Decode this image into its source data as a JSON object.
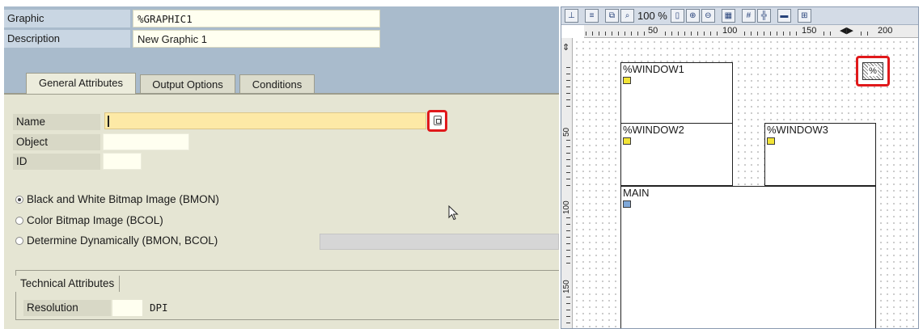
{
  "header": {
    "graphic_label": "Graphic",
    "graphic_value": "%GRAPHIC1",
    "description_label": "Description",
    "description_value": "New Graphic 1"
  },
  "tabs": [
    {
      "label": "General Attributes",
      "active": true
    },
    {
      "label": "Output Options",
      "active": false
    },
    {
      "label": "Conditions",
      "active": false
    }
  ],
  "fields": {
    "name_label": "Name",
    "name_value": "",
    "object_label": "Object",
    "object_value": "",
    "id_label": "ID",
    "id_value": ""
  },
  "color_mode": {
    "options": [
      {
        "label": "Black and White Bitmap Image (BMON)",
        "selected": true
      },
      {
        "label": "Color Bitmap Image (BCOL)",
        "selected": false
      },
      {
        "label": "Determine Dynamically (BMON, BCOL)",
        "selected": false
      }
    ]
  },
  "technical": {
    "group_title": "Technical Attributes",
    "resolution_label": "Resolution",
    "resolution_value": "",
    "resolution_unit": "DPI"
  },
  "layout_toolbar": {
    "zoom": "100 %"
  },
  "ruler": {
    "h_labels": [
      "50",
      "100",
      "150",
      "200"
    ],
    "v_labels": [
      "50",
      "100",
      "150"
    ]
  },
  "layout_windows": [
    {
      "name": "%WINDOW1",
      "icon": "window-icon"
    },
    {
      "name": "%WINDOW2",
      "icon": "window-icon"
    },
    {
      "name": "%WINDOW3",
      "icon": "window-icon"
    },
    {
      "name": "MAIN",
      "icon": "main-window-icon"
    }
  ],
  "graphic_node": {
    "label": "%"
  },
  "colors": {
    "highlight": "#e0191b",
    "panel_bg": "#e5e5d3",
    "header_bg": "#a9bbcc",
    "input_required": "#fde9a6"
  }
}
